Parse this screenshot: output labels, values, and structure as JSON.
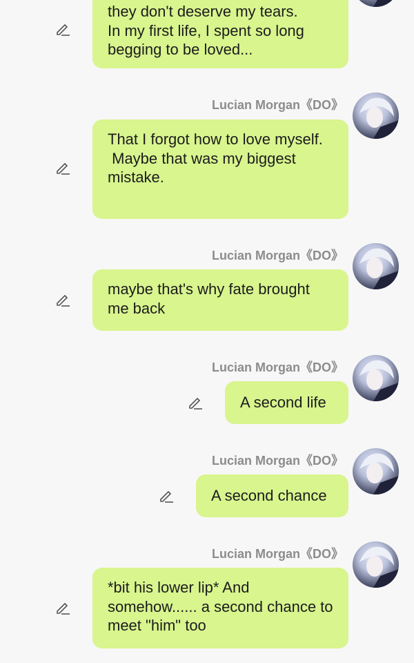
{
  "messages": [
    {
      "sender": "",
      "text": "they don't deserve my tears.\nIn my first life, I spent so long begging to be loved..."
    },
    {
      "sender": "Lucian Morgan《DO》",
      "text": "That I forgot how to love myself.\n Maybe that was my biggest mistake."
    },
    {
      "sender": "Lucian Morgan《DO》",
      "text": "maybe that's why fate brought me back"
    },
    {
      "sender": "Lucian Morgan《DO》",
      "text": "A second life"
    },
    {
      "sender": "Lucian Morgan《DO》",
      "text": "A second chance"
    },
    {
      "sender": "Lucian Morgan《DO》",
      "text": "*bit his lower lip* And somehow...... a second chance to meet \"him\" too"
    }
  ],
  "colors": {
    "bubble": "#d8f58e",
    "background": "#f7f7f7",
    "name": "#8c8c8c"
  }
}
